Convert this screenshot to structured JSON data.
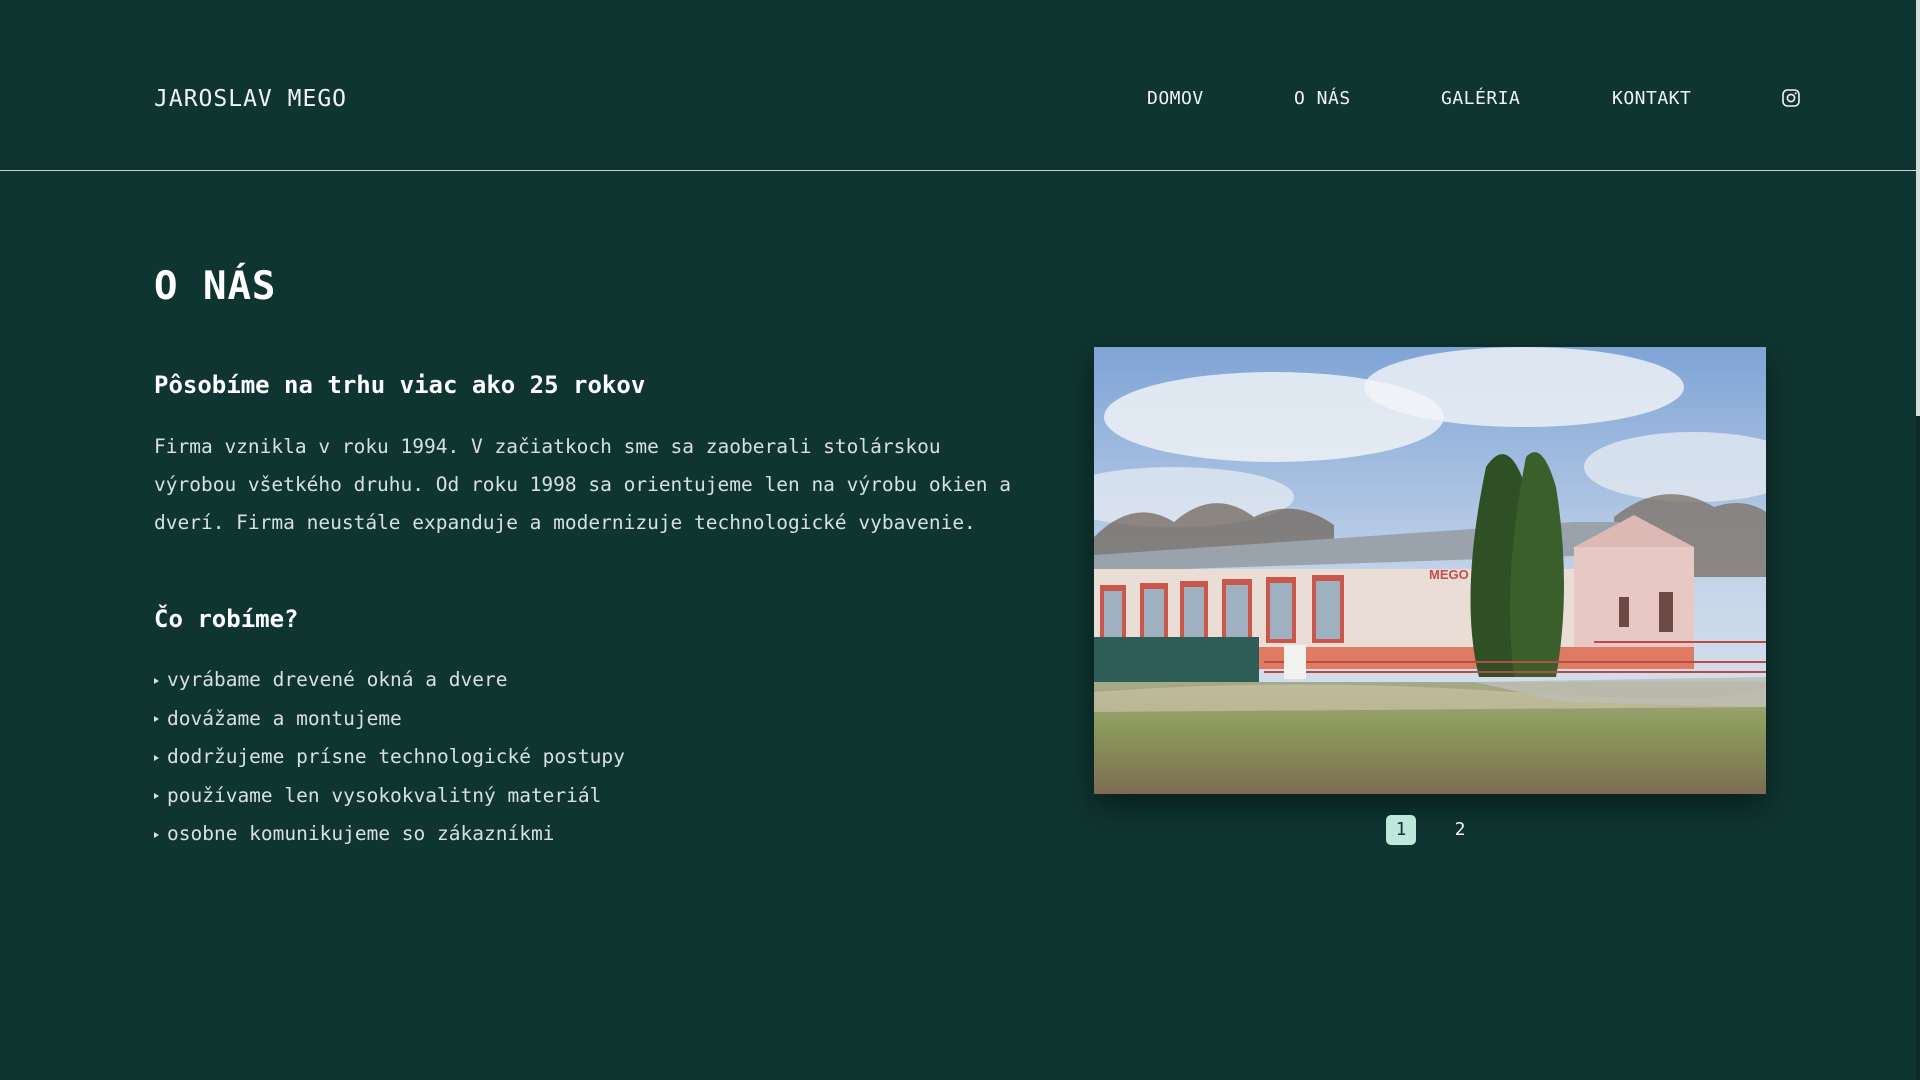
{
  "header": {
    "brand": "JAROSLAV MEGO",
    "nav": [
      "DOMOV",
      "O NÁS",
      "GALÉRIA",
      "KONTAKT"
    ],
    "social_icon": "instagram-icon"
  },
  "main": {
    "title": "O NÁS",
    "subtitle1": "Pôsobíme na trhu viac ako 25 rokov",
    "paragraph": "Firma vznikla v roku 1994. V začiatkoch sme sa zaoberali stolárskou výrobou všetkého druhu. Od roku 1998 sa orientujeme len na výrobu okien a dverí. Firma neustále expanduje a modernizuje technologické vybavenie.",
    "subtitle2": "Čo robíme?",
    "list": [
      "vyrábame drevené okná a dvere",
      "dovážame a montujeme",
      "dodržujeme prísne technologické postupy",
      "používame len vysokokvalitný materiál",
      "osobne komunikujeme so zákazníkmi"
    ]
  },
  "gallery": {
    "sign_text": "MEGO",
    "pages": [
      "1",
      "2"
    ],
    "active_page": "1"
  },
  "colors": {
    "background": "#0f3530",
    "accent": "#bfe8dc",
    "text": "#e6ecea"
  }
}
